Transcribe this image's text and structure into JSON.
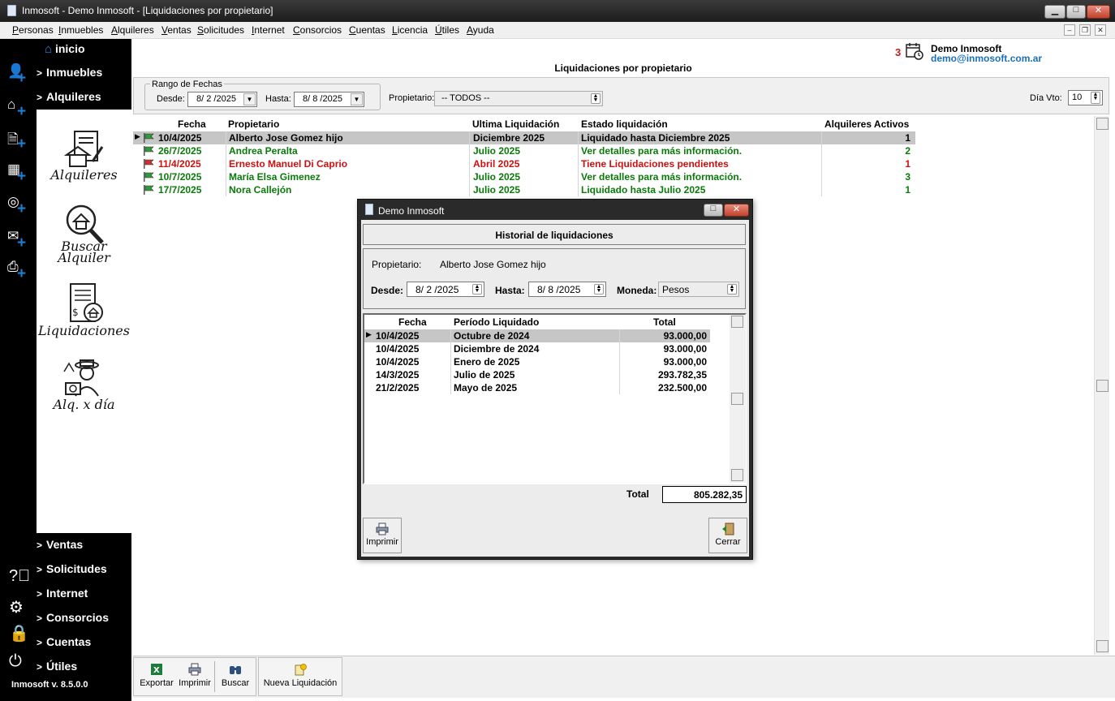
{
  "window": {
    "title": "Inmosoft - Demo Inmosoft - [Liquidaciones por propietario]",
    "controls": {
      "minimize": "▁",
      "maximize": "□",
      "close": "✕"
    }
  },
  "menu": [
    "Personas",
    "Inmuebles",
    "Alquileres",
    "Ventas",
    "Solicitudes",
    "Internet",
    "Consorcios",
    "Cuentas",
    "Licencia",
    "Útiles",
    "Ayuda"
  ],
  "mdi_controls": {
    "minimize": "–",
    "restore": "❐",
    "close": "✕"
  },
  "sidebar": {
    "home_label": "inicio",
    "top_items": [
      "Inmuebles",
      "Alquileres"
    ],
    "panel_items": [
      "Alquileres",
      "Buscar Alquiler",
      "Liquidaciones",
      "Alq. x día"
    ],
    "bottom_items": [
      "Ventas",
      "Solicitudes",
      "Internet",
      "Consorcios",
      "Cuentas",
      "Útiles"
    ],
    "chevron": ">",
    "version": "Inmosoft v. 8.5.0.0"
  },
  "user": {
    "reminders": "3",
    "name": "Demo Inmosoft",
    "email": "demo@inmosoft.com.ar"
  },
  "form": {
    "title": "Liquidaciones por propietario",
    "filters": {
      "group_label": "Rango de Fechas",
      "desde_label": "Desde:",
      "desde_value": "8/ 2 /2025",
      "hasta_label": "Hasta:",
      "hasta_value": "8/ 8 /2025",
      "propietario_label": "Propietario:",
      "propietario_value": "-- TODOS --",
      "dia_vto_label": "Día Vto:",
      "dia_vto_value": "10"
    },
    "grid": {
      "headers": [
        "Fecha",
        "Propietario",
        "Ultima Liquidación",
        "Estado liquidación",
        "Alquileres Activos"
      ],
      "rows": [
        {
          "fecha": "10/4/2025",
          "propietario": "Alberto Jose Gomez hijo",
          "ultima": "Diciembre 2025",
          "estado": "Liquidado hasta Diciembre 2025",
          "activos": "1",
          "color": "#000000",
          "flag": "green"
        },
        {
          "fecha": "26/7/2025",
          "propietario": "Andrea Peralta",
          "ultima": "Julio 2025",
          "estado": "Ver detalles para más información.",
          "activos": "2",
          "color": "#0a7a0a",
          "flag": "green"
        },
        {
          "fecha": "11/4/2025",
          "propietario": "Ernesto Manuel Di Caprio",
          "ultima": "Abril 2025",
          "estado": "Tiene Liquidaciones pendientes",
          "activos": "1",
          "color": "#cc1111",
          "flag": "red"
        },
        {
          "fecha": "10/7/2025",
          "propietario": "María Elsa Gimenez",
          "ultima": "Julio 2025",
          "estado": "Ver detalles para más información.",
          "activos": "3",
          "color": "#0a7a0a",
          "flag": "green"
        },
        {
          "fecha": "17/7/2025",
          "propietario": "Nora Callejón",
          "ultima": "Julio 2025",
          "estado": "Liquidado hasta Julio 2025",
          "activos": "1",
          "color": "#0a7a0a",
          "flag": "green"
        }
      ]
    },
    "toolbar": {
      "exportar": "Exportar",
      "imprimir": "Imprimir",
      "buscar": "Buscar",
      "nueva": "Nueva Liquidación"
    }
  },
  "dialog": {
    "title": "Demo Inmosoft",
    "header": "Historial de liquidaciones",
    "propietario_label": "Propietario:",
    "propietario_value": "Alberto Jose Gomez hijo",
    "desde_label": "Desde:",
    "desde_value": "8/ 2 /2025",
    "hasta_label": "Hasta:",
    "hasta_value": "8/ 8 /2025",
    "moneda_label": "Moneda:",
    "moneda_value": "Pesos",
    "grid": {
      "headers": [
        "Fecha",
        "Período Liquidado",
        "Total"
      ],
      "rows": [
        {
          "fecha": "10/4/2025",
          "periodo": "Octubre de 2024",
          "total": "93.000,00"
        },
        {
          "fecha": "10/4/2025",
          "periodo": "Diciembre de 2024",
          "total": "93.000,00"
        },
        {
          "fecha": "10/4/2025",
          "periodo": "Enero de 2025",
          "total": "93.000,00"
        },
        {
          "fecha": "14/3/2025",
          "periodo": "Julio de 2025",
          "total": "293.782,35"
        },
        {
          "fecha": "21/2/2025",
          "periodo": "Mayo de 2025",
          "total": "232.500,00"
        }
      ]
    },
    "total_label": "Total",
    "total_value": "805.282,35",
    "imprimir": "Imprimir",
    "cerrar": "Cerrar"
  }
}
